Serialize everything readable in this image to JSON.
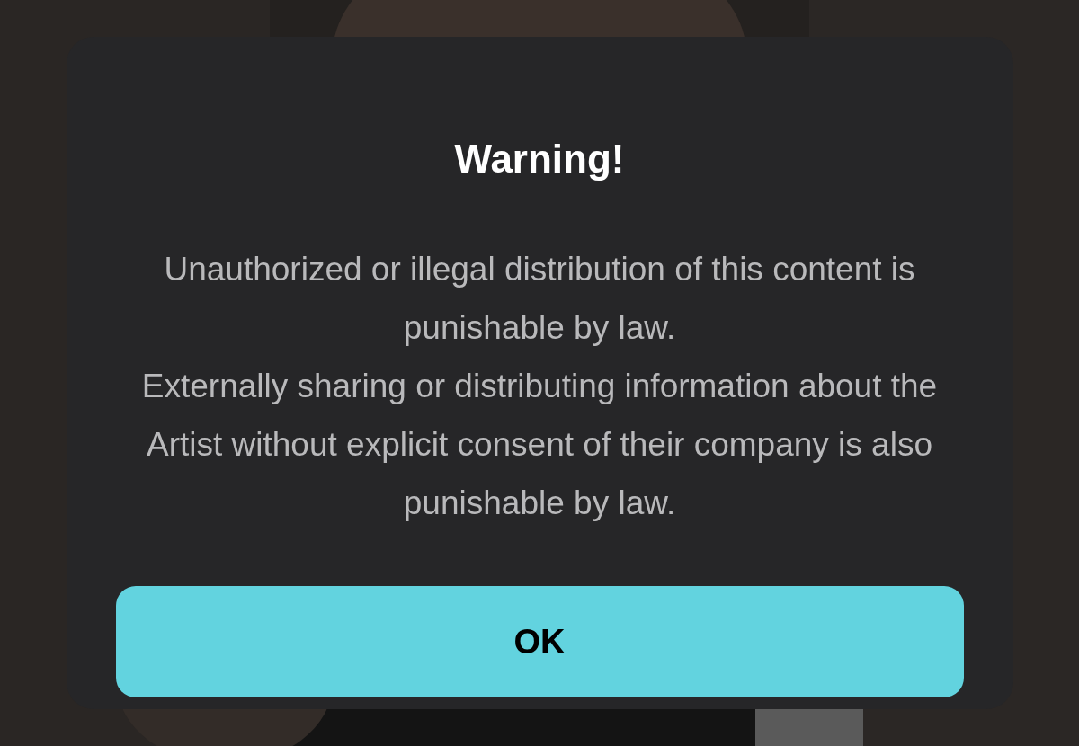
{
  "dialog": {
    "title": "Warning!",
    "paragraphs": [
      "Unauthorized or illegal distribution of this content is punishable by law.",
      "Externally sharing or distributing information about the Artist without explicit consent of their company is also punishable by law."
    ],
    "buttons": [
      "OK"
    ]
  }
}
